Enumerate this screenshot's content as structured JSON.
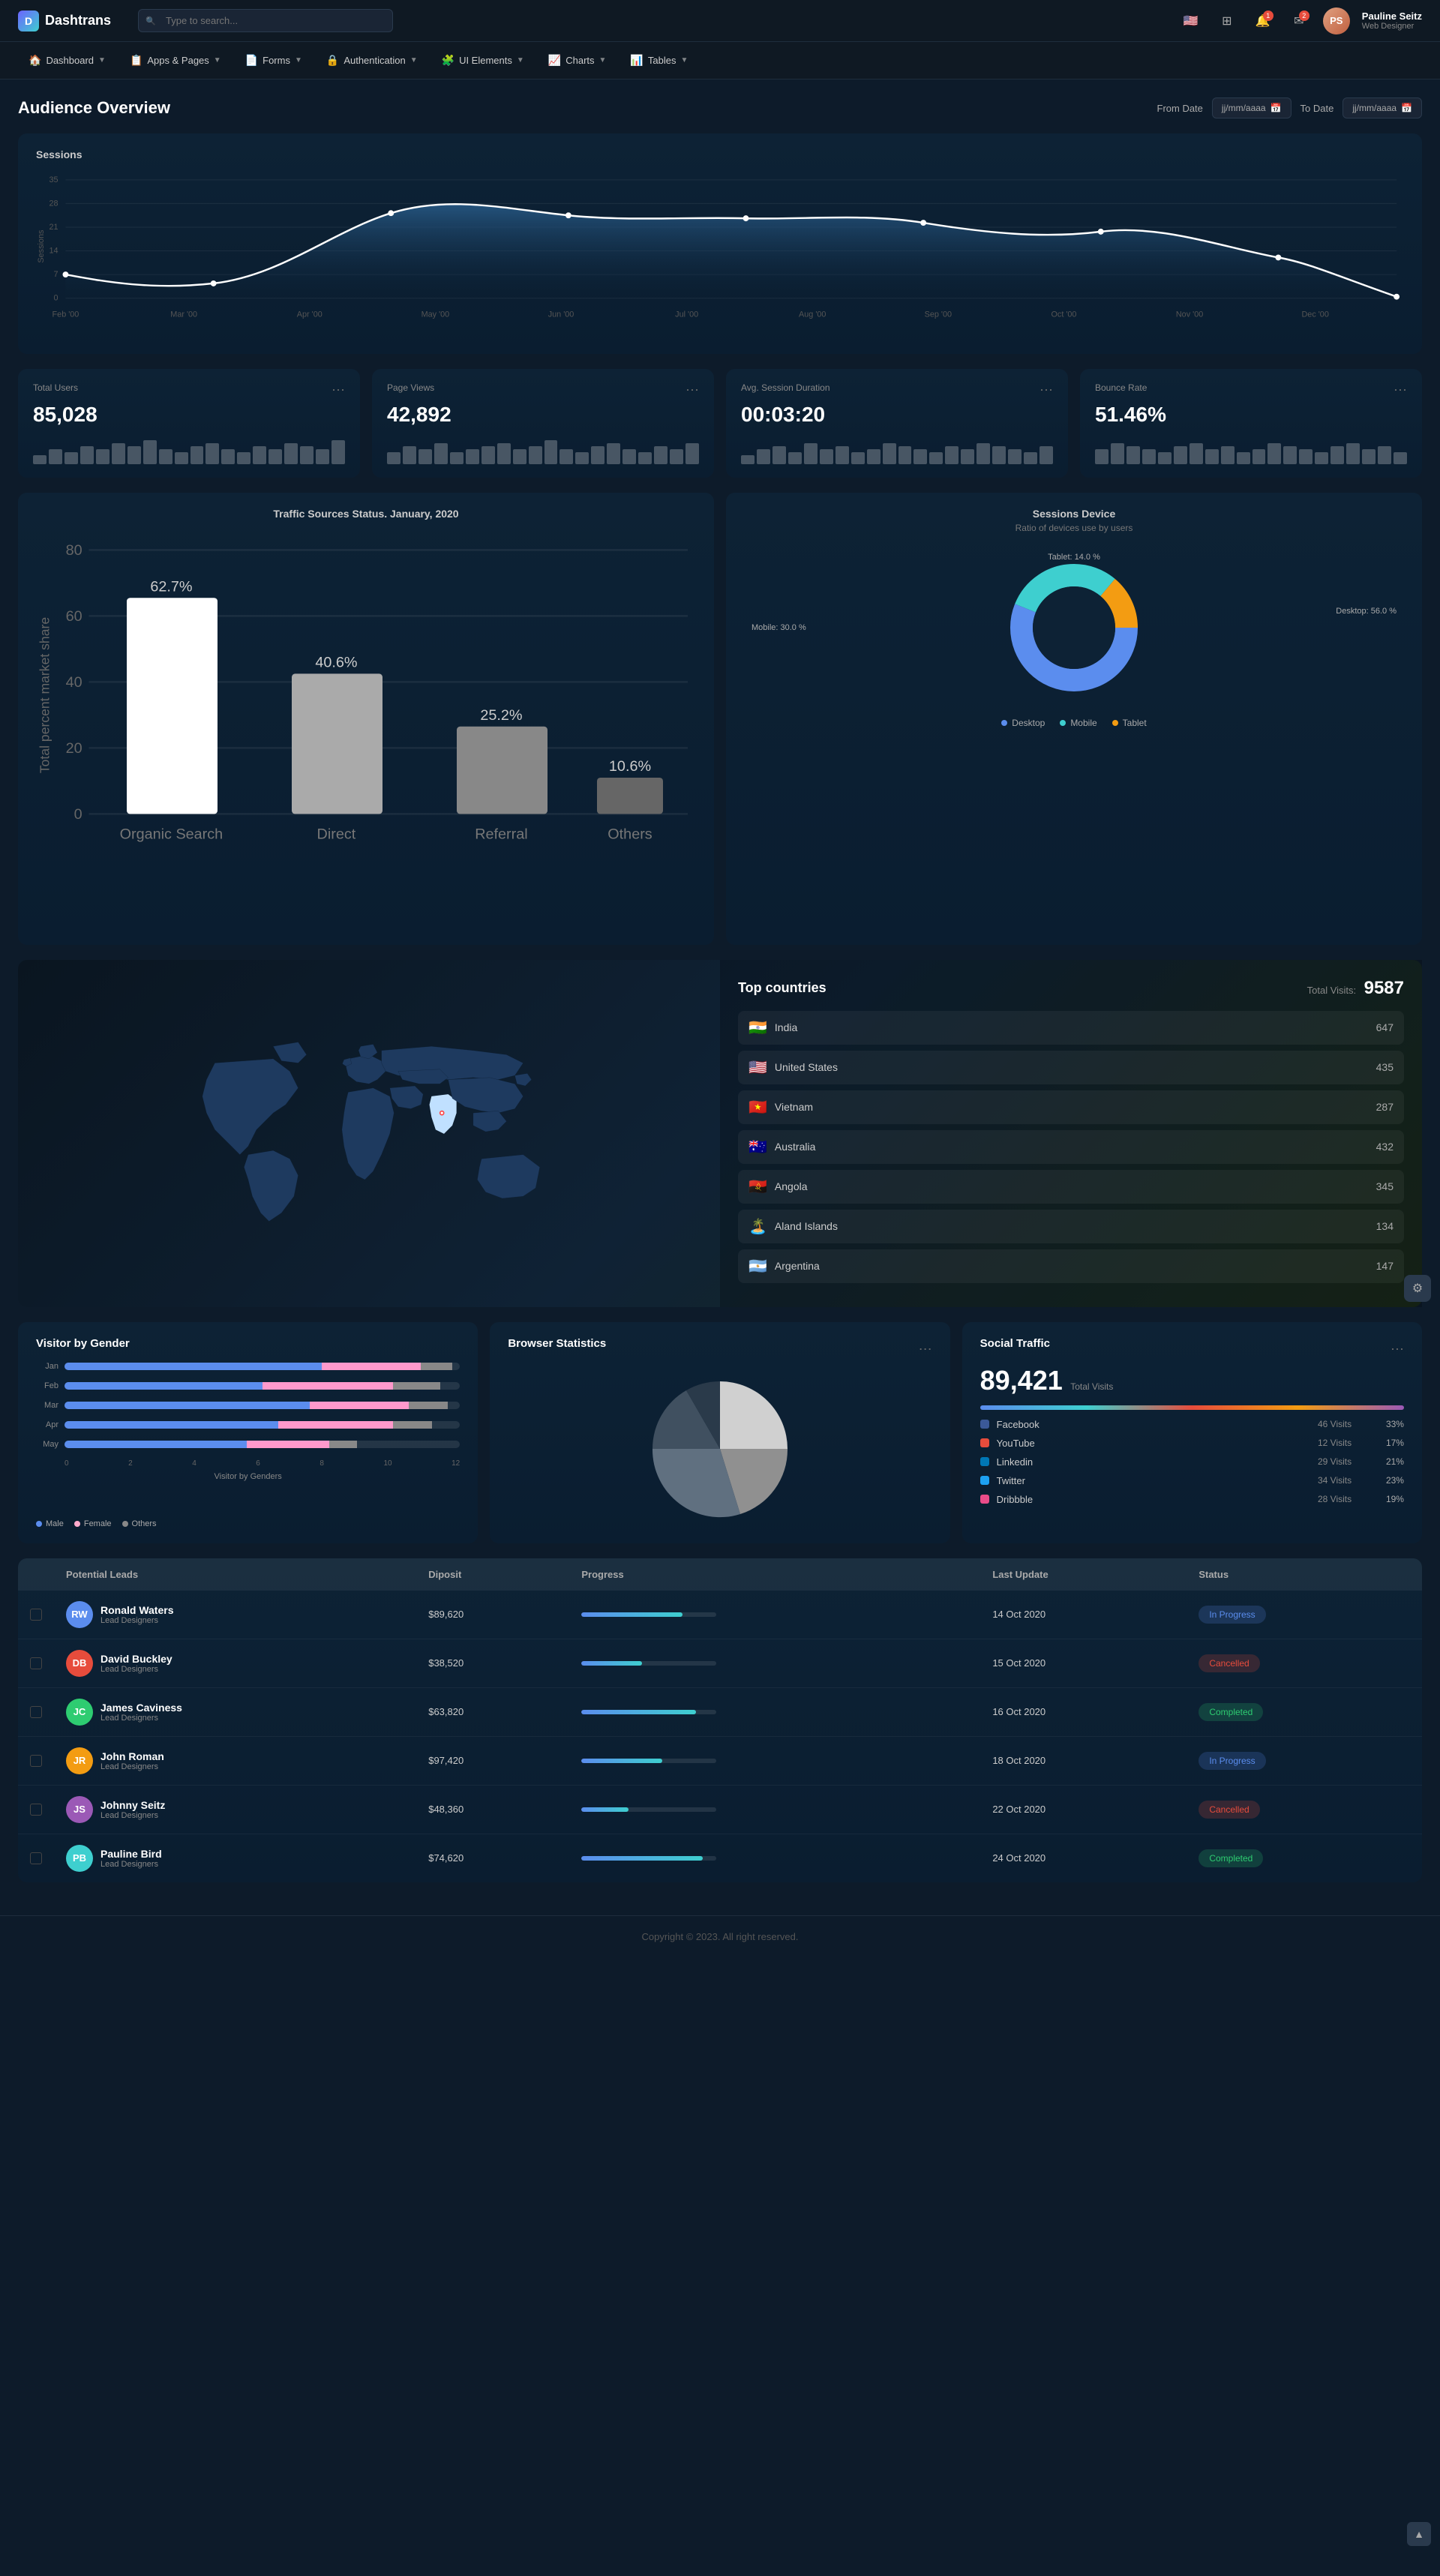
{
  "app": {
    "name": "Dashtrans"
  },
  "topnav": {
    "search_placeholder": "Type to search...",
    "user_name": "Pauline Seitz",
    "user_role": "Web Designer",
    "user_initials": "PS",
    "notification_count": "1",
    "message_count": "2"
  },
  "mainnav": {
    "items": [
      {
        "label": "Dashboard",
        "icon": "🏠"
      },
      {
        "label": "Apps & Pages",
        "icon": "📋"
      },
      {
        "label": "Forms",
        "icon": "📄"
      },
      {
        "label": "Authentication",
        "icon": "🔒"
      },
      {
        "label": "UI Elements",
        "icon": "🧩"
      },
      {
        "label": "Charts",
        "icon": "📈"
      },
      {
        "label": "Tables",
        "icon": "📊"
      }
    ]
  },
  "audience": {
    "title": "Audience Overview",
    "from_label": "From Date",
    "to_label": "To Date",
    "date_placeholder": "jj/mm/aaaa"
  },
  "sessions": {
    "title": "Sessions",
    "months": [
      "Feb '00",
      "Mar '00",
      "Apr '00",
      "May '00",
      "Jun '00",
      "Jul '00",
      "Aug '00",
      "Sep '00",
      "Oct '00",
      "Nov '00",
      "Dec '00"
    ],
    "y_labels": [
      "35",
      "28",
      "21",
      "14",
      "7",
      "0"
    ]
  },
  "stats": [
    {
      "label": "Total Users",
      "value": "85,028",
      "bars": [
        3,
        5,
        4,
        6,
        5,
        7,
        6,
        8,
        5,
        4,
        6,
        7,
        5,
        4,
        6,
        5,
        7,
        6,
        5,
        8
      ]
    },
    {
      "label": "Page Views",
      "value": "42,892",
      "bars": [
        4,
        6,
        5,
        7,
        4,
        5,
        6,
        7,
        5,
        6,
        8,
        5,
        4,
        6,
        7,
        5,
        4,
        6,
        5,
        7
      ]
    },
    {
      "label": "Avg. Session Duration",
      "value": "00:03:20",
      "bars": [
        3,
        5,
        6,
        4,
        7,
        5,
        6,
        4,
        5,
        7,
        6,
        5,
        4,
        6,
        5,
        7,
        6,
        5,
        4,
        6
      ]
    },
    {
      "label": "Bounce Rate",
      "value": "51.46%",
      "bars": [
        5,
        7,
        6,
        5,
        4,
        6,
        7,
        5,
        6,
        4,
        5,
        7,
        6,
        5,
        4,
        6,
        7,
        5,
        6,
        4
      ]
    }
  ],
  "traffic_sources": {
    "title": "Traffic Sources Status. January, 2020",
    "y_label": "Total percent market share",
    "bars": [
      {
        "label": "Organic Search",
        "value": 62.7,
        "pct": "62.7%"
      },
      {
        "label": "Direct",
        "value": 40.6,
        "pct": "40.6%"
      },
      {
        "label": "Referral",
        "value": 25.2,
        "pct": "25.2%"
      },
      {
        "label": "Others",
        "value": 10.6,
        "pct": "10.6%"
      }
    ]
  },
  "sessions_device": {
    "title": "Sessions Device",
    "subtitle": "Ratio of devices use by users",
    "desktop_pct": 56.0,
    "mobile_pct": 30.0,
    "tablet_pct": 14.0,
    "desktop_label": "Desktop: 56.0 %",
    "mobile_label": "Mobile: 30.0 %",
    "tablet_label": "Tablet: 14.0 %",
    "legend": [
      {
        "label": "Desktop",
        "color": "#5b8dee"
      },
      {
        "label": "Mobile",
        "color": "#3ecfcf"
      },
      {
        "label": "Tablet",
        "color": "#f39c12"
      }
    ]
  },
  "top_countries": {
    "title": "Top countries",
    "total_label": "Total Visits:",
    "total": "9587",
    "countries": [
      {
        "name": "India",
        "count": "647",
        "flag": "🇮🇳"
      },
      {
        "name": "United States",
        "count": "435",
        "flag": "🇺🇸"
      },
      {
        "name": "Vietnam",
        "count": "287",
        "flag": "🇻🇳"
      },
      {
        "name": "Australia",
        "count": "432",
        "flag": "🇦🇺"
      },
      {
        "name": "Angola",
        "count": "345",
        "flag": "🇦🇴"
      },
      {
        "name": "Aland Islands",
        "count": "134",
        "flag": "🏝️"
      },
      {
        "name": "Argentina",
        "count": "147",
        "flag": "🇦🇷"
      }
    ]
  },
  "visitor_gender": {
    "title": "Visitor by Gender",
    "x_label": "Visitor by Genders",
    "months": [
      "Jan",
      "Feb",
      "Mar",
      "Apr",
      "May"
    ],
    "data": [
      {
        "male": 80,
        "female": 30,
        "others": 10
      },
      {
        "male": 60,
        "female": 40,
        "others": 15
      },
      {
        "male": 75,
        "female": 50,
        "others": 20
      },
      {
        "male": 65,
        "female": 35,
        "others": 12
      },
      {
        "male": 55,
        "female": 25,
        "others": 8
      }
    ],
    "x_ticks": [
      "0",
      "2",
      "4",
      "6",
      "8",
      "10",
      "12"
    ],
    "legend": [
      {
        "label": "Male",
        "color": "#5b8dee"
      },
      {
        "label": "Female",
        "color": "#ffaacc"
      },
      {
        "label": "Others",
        "color": "#888"
      }
    ]
  },
  "browser_stats": {
    "title": "Browser Statistics",
    "segments": [
      {
        "pct": 30,
        "color": "#e0e0e0"
      },
      {
        "pct": 25,
        "color": "#b0b0b0"
      },
      {
        "pct": 20,
        "color": "#607080"
      },
      {
        "pct": 15,
        "color": "#405060"
      },
      {
        "pct": 10,
        "color": "#2a3a4a"
      }
    ]
  },
  "social_traffic": {
    "title": "Social Traffic",
    "total": "89,421",
    "total_label": "Total Visits",
    "rows": [
      {
        "name": "Facebook",
        "visits": "46 Visits",
        "pct": "33%",
        "color": "#3b5998"
      },
      {
        "name": "YouTube",
        "visits": "12 Visits",
        "pct": "17%",
        "color": "#e74c3c"
      },
      {
        "name": "Linkedin",
        "visits": "29 Visits",
        "pct": "21%",
        "color": "#0077b5"
      },
      {
        "name": "Twitter",
        "visits": "34 Visits",
        "pct": "23%",
        "color": "#1da1f2"
      },
      {
        "name": "Dribbble",
        "visits": "28 Visits",
        "pct": "19%",
        "color": "#ea4c89"
      }
    ]
  },
  "leads": {
    "headers": [
      "Potential Leads",
      "Diposit",
      "Progress",
      "Last Update",
      "Status"
    ],
    "rows": [
      {
        "name": "Ronald Waters",
        "role": "Lead Designers",
        "deposit": "$89,620",
        "progress": 75,
        "date": "14 Oct 2020",
        "status": "In Progress",
        "status_type": "inprogress",
        "color": "#5b8dee",
        "initials": "RW"
      },
      {
        "name": "David Buckley",
        "role": "Lead Designers",
        "deposit": "$38,520",
        "progress": 45,
        "date": "15 Oct 2020",
        "status": "Cancelled",
        "status_type": "cancelled",
        "color": "#e74c3c",
        "initials": "DB"
      },
      {
        "name": "James Caviness",
        "role": "Lead Designers",
        "deposit": "$63,820",
        "progress": 85,
        "date": "16 Oct 2020",
        "status": "Completed",
        "status_type": "completed",
        "color": "#2ecc71",
        "initials": "JC"
      },
      {
        "name": "John Roman",
        "role": "Lead Designers",
        "deposit": "$97,420",
        "progress": 60,
        "date": "18 Oct 2020",
        "status": "In Progress",
        "status_type": "inprogress",
        "color": "#f39c12",
        "initials": "JR"
      },
      {
        "name": "Johnny Seitz",
        "role": "Lead Designers",
        "deposit": "$48,360",
        "progress": 35,
        "date": "22 Oct 2020",
        "status": "Cancelled",
        "status_type": "cancelled",
        "color": "#9b59b6",
        "initials": "JS"
      },
      {
        "name": "Pauline Bird",
        "role": "Lead Designers",
        "deposit": "$74,620",
        "progress": 90,
        "date": "24 Oct 2020",
        "status": "Completed",
        "status_type": "completed",
        "color": "#3ecfcf",
        "initials": "PB"
      }
    ]
  },
  "footer": {
    "text": "Copyright © 2023. All right reserved."
  }
}
